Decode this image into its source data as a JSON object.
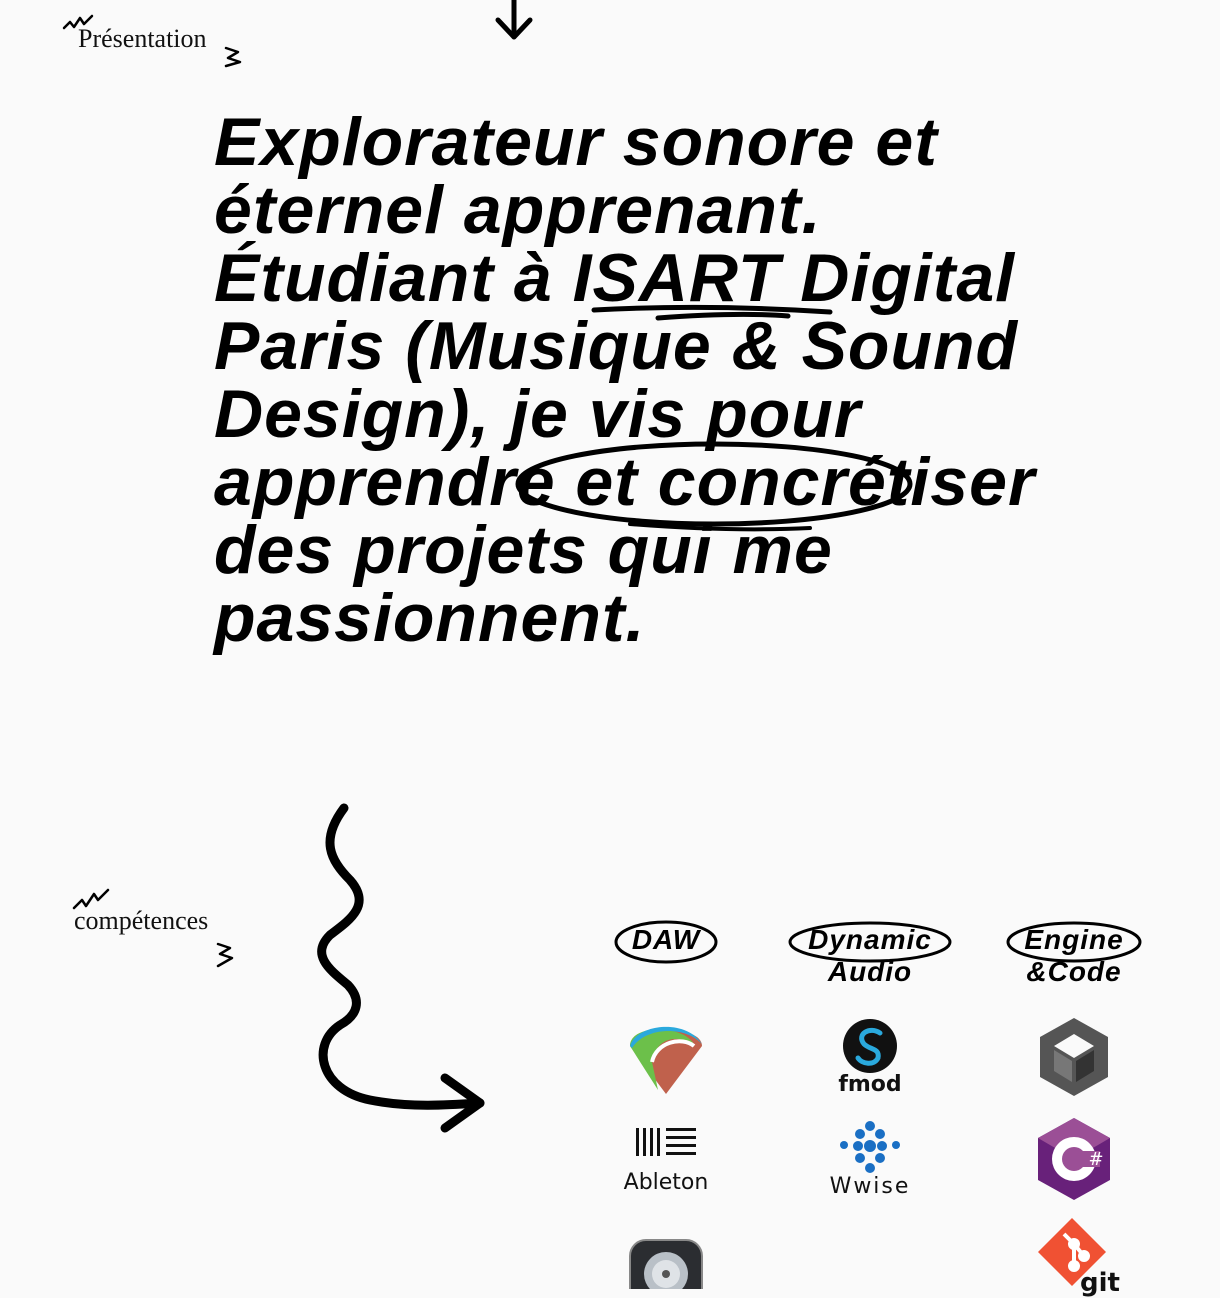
{
  "presentation": {
    "label": "Présentation",
    "headline_parts": {
      "p1": "Explorateur sonore et éternel apprenant. Étudiant à ",
      "isart": "ISART",
      "p2": " Digital Paris (Musique & Sound Design), je vis pour ",
      "apprendre": "apprendre",
      "p3": " et concrétiser des projets qui me passionnent."
    }
  },
  "competences": {
    "label": "compétences",
    "columns": [
      {
        "title": "DAW",
        "logos": [
          "reaper-logo",
          "ableton-logo",
          "logic-pro-logo"
        ]
      },
      {
        "title": "Dynamic Audio",
        "logos": [
          "fmod-logo",
          "wwise-logo"
        ]
      },
      {
        "title": "Engine &Code",
        "logos": [
          "unity-logo",
          "csharp-logo",
          "git-logo"
        ]
      }
    ],
    "logo_texts": {
      "ableton": "Ableton",
      "fmod": "fmod",
      "wwise": "Wwise",
      "git": "git",
      "csharp": "#"
    }
  }
}
